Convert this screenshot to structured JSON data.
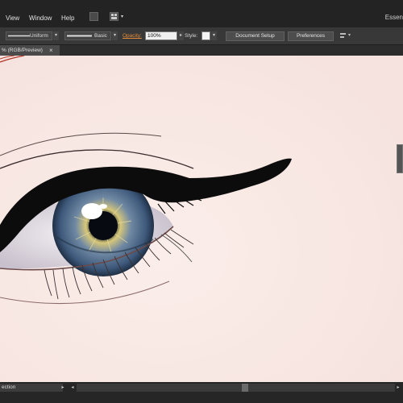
{
  "menubar": {
    "items": [
      "View",
      "Window",
      "Help"
    ],
    "workspace_label": "Essen"
  },
  "control_bar": {
    "stroke_profile": "Uniform",
    "brush": "Basic",
    "opacity_label": "Opacity:",
    "opacity_value": "100%",
    "style_label": "Style:",
    "document_setup": "Document Setup",
    "preferences": "Preferences"
  },
  "tab": {
    "title": "% (RGB/Preview)",
    "close": "×"
  },
  "status": {
    "tool_text": "ection"
  },
  "colors": {
    "canvas_bg": "#f9ebe8",
    "opacity_accent": "#e08a3a",
    "iris": "#4b6a8a",
    "iris_gold": "#d7c77a",
    "eyeliner": "#0c0c0c"
  },
  "icons": {
    "arrange_documents": "arrange-docs-icon",
    "bridge": "br-icon",
    "align": "align-icon"
  }
}
